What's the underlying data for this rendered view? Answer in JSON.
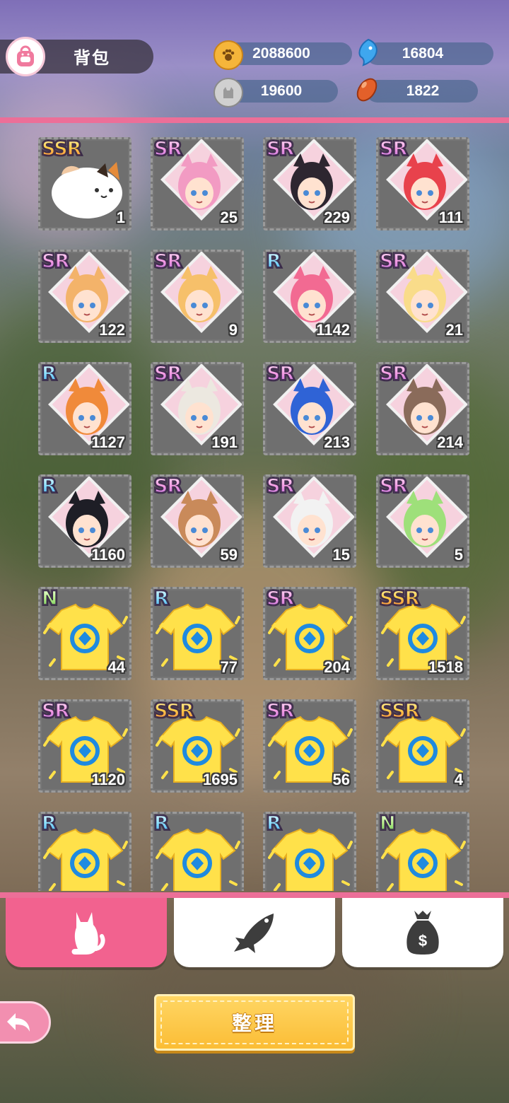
{
  "header": {
    "title": "背包",
    "resources": [
      {
        "name": "paw-coin",
        "value": "2088600",
        "color": "#f5b53a"
      },
      {
        "name": "fish-gem",
        "value": "16804",
        "color": "#3fa7ee"
      },
      {
        "name": "silver-token",
        "value": "19600",
        "color": "#c8c8c8"
      },
      {
        "name": "bean",
        "value": "1822",
        "color": "#e3602a"
      }
    ]
  },
  "grid": {
    "items": [
      {
        "rarity": "SSR",
        "count": "1",
        "kind": "cat",
        "color": "#f1c9a3"
      },
      {
        "rarity": "SR",
        "count": "25",
        "kind": "portrait",
        "color": "#f29bc3"
      },
      {
        "rarity": "SR",
        "count": "229",
        "kind": "portrait",
        "color": "#2d2630"
      },
      {
        "rarity": "SR",
        "count": "111",
        "kind": "portrait",
        "color": "#e8424c"
      },
      {
        "rarity": "SR",
        "count": "122",
        "kind": "portrait",
        "color": "#f3b36a"
      },
      {
        "rarity": "SR",
        "count": "9",
        "kind": "portrait",
        "color": "#f6c06a"
      },
      {
        "rarity": "R",
        "count": "1142",
        "kind": "portrait",
        "color": "#f26a92"
      },
      {
        "rarity": "SR",
        "count": "21",
        "kind": "portrait",
        "color": "#f9dc8a"
      },
      {
        "rarity": "R",
        "count": "1127",
        "kind": "portrait",
        "color": "#f08a3a"
      },
      {
        "rarity": "SR",
        "count": "191",
        "kind": "portrait",
        "color": "#ece8e0"
      },
      {
        "rarity": "SR",
        "count": "213",
        "kind": "portrait",
        "color": "#2f63d6"
      },
      {
        "rarity": "SR",
        "count": "214",
        "kind": "portrait",
        "color": "#8a6b5a"
      },
      {
        "rarity": "R",
        "count": "1160",
        "kind": "portrait",
        "color": "#1e1e26"
      },
      {
        "rarity": "SR",
        "count": "59",
        "kind": "portrait",
        "color": "#c98a5a"
      },
      {
        "rarity": "SR",
        "count": "15",
        "kind": "portrait",
        "color": "#f2f2f2"
      },
      {
        "rarity": "SR",
        "count": "5",
        "kind": "portrait",
        "color": "#9ee07a"
      },
      {
        "rarity": "N",
        "count": "44",
        "kind": "shirt",
        "color": "#ffe14a"
      },
      {
        "rarity": "R",
        "count": "77",
        "kind": "shirt",
        "color": "#ffe14a"
      },
      {
        "rarity": "SR",
        "count": "204",
        "kind": "shirt",
        "color": "#ffe14a"
      },
      {
        "rarity": "SSR",
        "count": "1518",
        "kind": "shirt",
        "color": "#ffe14a"
      },
      {
        "rarity": "SR",
        "count": "1120",
        "kind": "shirt",
        "color": "#ffe14a"
      },
      {
        "rarity": "SSR",
        "count": "1695",
        "kind": "shirt",
        "color": "#ffe14a"
      },
      {
        "rarity": "SR",
        "count": "56",
        "kind": "shirt",
        "color": "#ffe14a"
      },
      {
        "rarity": "SSR",
        "count": "4",
        "kind": "shirt",
        "color": "#ffe14a"
      },
      {
        "rarity": "R",
        "count": "",
        "kind": "shirt",
        "color": "#ffe14a"
      },
      {
        "rarity": "R",
        "count": "",
        "kind": "shirt",
        "color": "#ffe14a"
      },
      {
        "rarity": "R",
        "count": "",
        "kind": "shirt",
        "color": "#ffe14a"
      },
      {
        "rarity": "N",
        "count": "",
        "kind": "shirt",
        "color": "#ffe14a"
      }
    ]
  },
  "tabs": [
    {
      "name": "cat-tab",
      "icon": "cat-icon",
      "active": true
    },
    {
      "name": "fish-tab",
      "icon": "fish-icon",
      "active": false
    },
    {
      "name": "money-bag-tab",
      "icon": "money-bag-icon",
      "active": false
    }
  ],
  "footer": {
    "sort_label": "整理",
    "back_icon": "back-arrow-icon"
  },
  "colors": {
    "accent_pink": "#ec6f98",
    "sort_yellow": "#fbbd35"
  }
}
